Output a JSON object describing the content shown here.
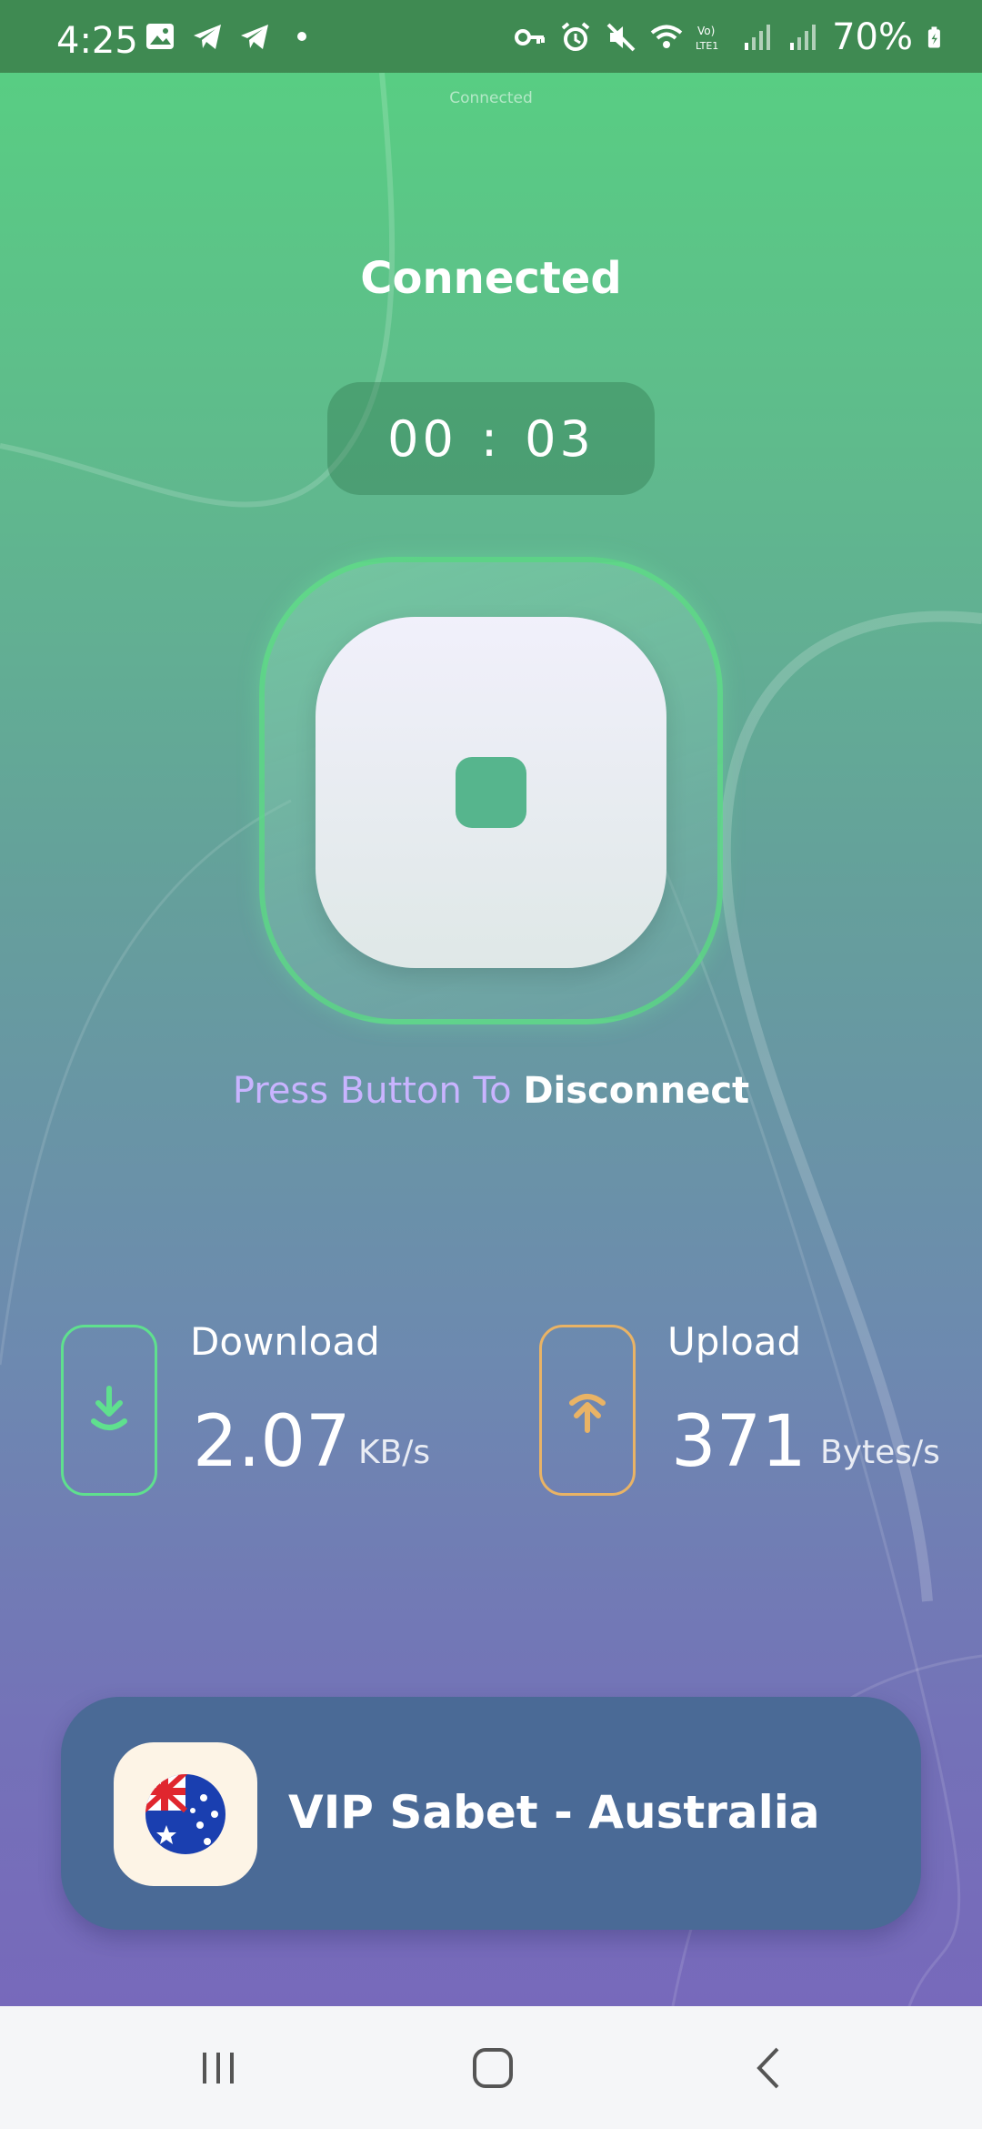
{
  "status_bar": {
    "time": "4:25",
    "battery": "70%",
    "left_icons": [
      "gallery-icon",
      "telegram-icon",
      "telegram-icon",
      "dot-icon"
    ],
    "right_icons": [
      "key-icon",
      "alarm-icon",
      "mute-icon",
      "wifi-icon",
      "volte-icon",
      "signal-icon",
      "signal-icon",
      "battery-icon"
    ]
  },
  "header": {
    "small_status": "Connected",
    "title": "Connected"
  },
  "timer": {
    "minutes": "00",
    "separator": ":",
    "seconds": "03"
  },
  "power_button": {
    "icon": "stop-icon"
  },
  "hint": {
    "prefix": "Press Button To ",
    "action": "Disconnect"
  },
  "stats": {
    "download": {
      "label": "Download",
      "value": "2.07",
      "unit": "KB/s",
      "color": "#5fe08e",
      "icon": "download-icon"
    },
    "upload": {
      "label": "Upload",
      "value": "371",
      "unit": "Bytes/s",
      "color": "#e9b365",
      "icon": "upload-icon"
    }
  },
  "server": {
    "name": "VIP Sabet - Australia",
    "flag": "australia-flag-icon"
  },
  "nav": {
    "items": [
      "recent-apps-icon",
      "home-icon",
      "back-icon"
    ]
  },
  "colors": {
    "status_bar": "#3f8a52",
    "card": "#4a6a96",
    "accent_green": "#56b58d"
  }
}
